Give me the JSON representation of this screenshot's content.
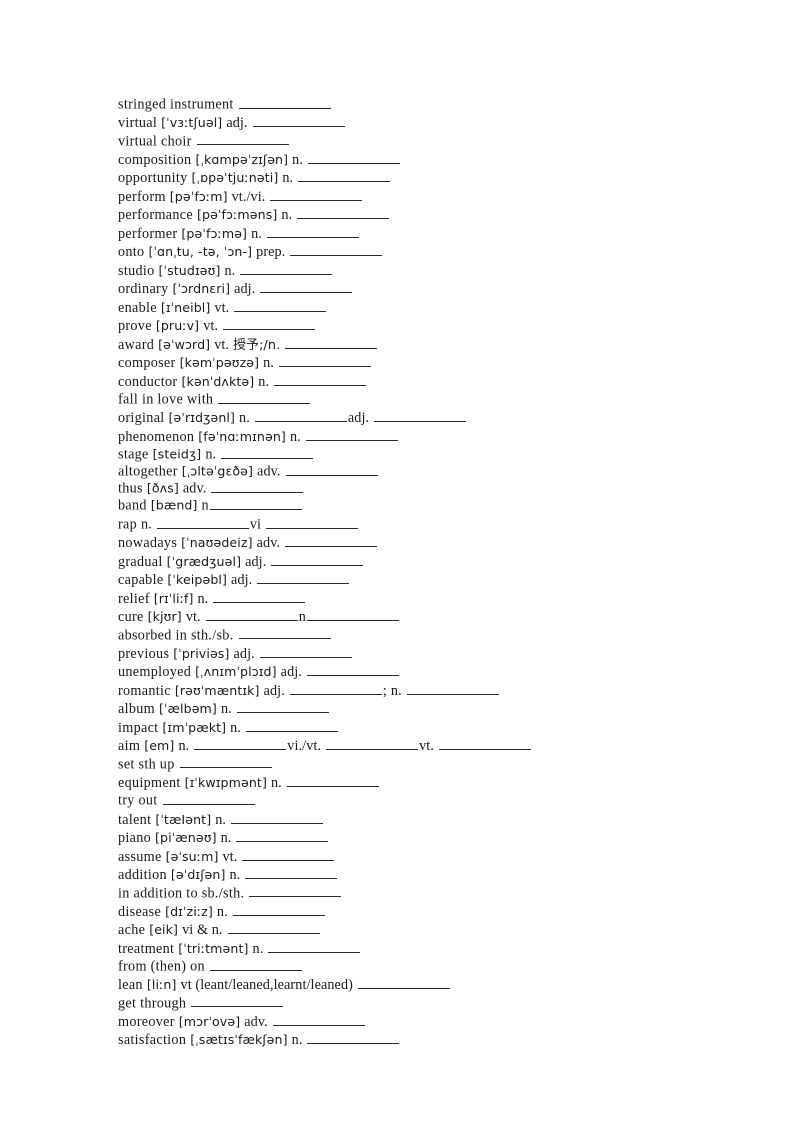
{
  "document": {
    "type": "vocabulary-worksheet",
    "language": "English",
    "entry_count": 48
  },
  "entries": [
    {
      "word": "stringed instrument",
      "ipa": "",
      "pos": "",
      "note": "",
      "blanks": [
        1
      ],
      "tight": false
    },
    {
      "word": "virtual",
      "ipa": "[ˈvɜːtʃuəl]",
      "pos": "adj.",
      "note": "",
      "blanks": [
        1
      ],
      "tight": false
    },
    {
      "word": "virtual choir",
      "ipa": "",
      "pos": "",
      "note": "",
      "blanks": [
        1
      ],
      "tight": false
    },
    {
      "word": "composition",
      "ipa": "[ˌkɑmpəˈzɪʃən]",
      "pos": "n.",
      "note": "",
      "blanks": [
        1
      ],
      "tight": false
    },
    {
      "word": "opportunity",
      "ipa": "[ˌɒpəˈtjuːnəti]",
      "pos": "n.",
      "note": "",
      "blanks": [
        1
      ],
      "tight": false
    },
    {
      "word": "perform",
      "ipa": "[pəˈfɔːm]",
      "pos": "vt./vi.",
      "note": "",
      "blanks": [
        1
      ],
      "tight": false
    },
    {
      "word": "performance",
      "ipa": "[pəˈfɔːməns]",
      "pos": "n.",
      "note": "",
      "blanks": [
        1
      ],
      "tight": false
    },
    {
      "word": "performer",
      "ipa": "[pəˈfɔːmə]",
      "pos": "n.",
      "note": "",
      "blanks": [
        1
      ],
      "tight": false
    },
    {
      "word": "onto",
      "ipa": "[ˈɑnˌtu, -tə, ˈɔn-]",
      "pos": "prep.",
      "note": "",
      "blanks": [
        1
      ],
      "tight": false
    },
    {
      "word": "studio",
      "ipa": "[ˈstudɪəʊ]",
      "pos": "n.",
      "note": "",
      "blanks": [
        1
      ],
      "tight": false
    },
    {
      "word": "ordinary",
      "ipa": "[ˈɔrdnɛri]",
      "pos": "adj.",
      "note": "",
      "blanks": [
        1
      ],
      "tight": false
    },
    {
      "word": "enable",
      "ipa": "[ɪˈneibl]",
      "pos": "vt.",
      "note": "",
      "blanks": [
        1
      ],
      "tight": false
    },
    {
      "word": "prove",
      "ipa": "[pruːv]",
      "pos": "vt.",
      "note": "",
      "blanks": [
        1
      ],
      "tight": false
    },
    {
      "word": "award",
      "ipa": "[əˈwɔrd]",
      "pos": "vt.",
      "note": "授予;/n.",
      "blanks": [
        1
      ],
      "tight": false
    },
    {
      "word": "composer",
      "ipa": "[kəmˈpəʊzə]",
      "pos": "n.",
      "note": "",
      "blanks": [
        1
      ],
      "tight": false
    },
    {
      "word": "conductor",
      "ipa": "[kənˈdʌktə]",
      "pos": "n.",
      "note": "",
      "blanks": [
        1
      ],
      "tight": false
    },
    {
      "word": "fall in love with",
      "ipa": "",
      "pos": "",
      "note": "",
      "blanks": [
        1
      ],
      "tight": false
    },
    {
      "word": "original",
      "ipa": "[əˈrɪdʒənl]",
      "pos": "n.",
      "note": "",
      "blanks": [
        1
      ],
      "tight": false,
      "trailing_pos": "adj.",
      "trailing_blanks": [
        1
      ]
    },
    {
      "word": "phenomenon",
      "ipa": "[fəˈnɑːmɪnən]",
      "pos": "n.",
      "note": "",
      "blanks": [
        1
      ],
      "tight": false
    },
    {
      "word": "stage",
      "ipa": "[steidʒ]",
      "pos": "n.",
      "note": "",
      "blanks": [
        1
      ],
      "tight": true
    },
    {
      "word": "altogether",
      "ipa": "[ˌɔltəˈgɛðə]",
      "pos": "adv.",
      "note": "",
      "blanks": [
        1
      ],
      "tight": true
    },
    {
      "word": "thus",
      "ipa": "[ðʌs]",
      "pos": "adv.",
      "note": "",
      "blanks": [
        1
      ],
      "tight": true
    },
    {
      "word": "band",
      "ipa": "[bænd]",
      "pos": "n",
      "note": "",
      "blanks": [
        1
      ],
      "tight": true,
      "no_space_before_blank": true
    },
    {
      "word": "rap",
      "ipa": "",
      "pos": "n.",
      "note": "",
      "blanks": [
        1
      ],
      "tight": false,
      "trailing_pos": "vi",
      "trailing_blanks": [
        1
      ]
    },
    {
      "word": "nowadays",
      "ipa": "[ˈnaʊədeiz]",
      "pos": "adv.",
      "note": "",
      "blanks": [
        1
      ],
      "tight": false
    },
    {
      "word": "gradual",
      "ipa": "[ˈgrædʒuəl]",
      "pos": "adj.",
      "note": "",
      "blanks": [
        1
      ],
      "tight": false
    },
    {
      "word": "capable",
      "ipa": "[ˈkeipəbl]",
      "pos": "adj.",
      "note": "",
      "blanks": [
        1
      ],
      "tight": false
    },
    {
      "word": "relief",
      "ipa": "[rɪˈliːf]",
      "pos": "n.",
      "note": "",
      "blanks": [
        1
      ],
      "tight": false
    },
    {
      "word": "cure",
      "ipa": "[kjʊr]",
      "pos": "vt.",
      "note": "",
      "blanks": [
        1
      ],
      "tight": false,
      "trailing_pos": "n",
      "trailing_blanks": [
        1
      ],
      "trailing_tight": true
    },
    {
      "word": "absorbed in sth./sb.",
      "ipa": "",
      "pos": "",
      "note": "",
      "blanks": [
        1
      ],
      "tight": false
    },
    {
      "word": "previous",
      "ipa": "[ˈpriviəs]",
      "pos": "adj.",
      "note": "",
      "blanks": [
        1
      ],
      "tight": false
    },
    {
      "word": "unemployed",
      "ipa": "[ˌʌnɪmˈplɔɪd]",
      "pos": "adj.",
      "note": "",
      "blanks": [
        1
      ],
      "tight": false
    },
    {
      "word": "romantic",
      "ipa": "[rəʊˈmæntɪk]",
      "pos": "adj.",
      "note": "",
      "blanks": [
        1
      ],
      "tight": false,
      "separator": ";",
      "trailing_pos": "n.",
      "trailing_blanks": [
        1
      ]
    },
    {
      "word": "album",
      "ipa": "[ˈælbəm]",
      "pos": "n.",
      "note": "",
      "blanks": [
        1
      ],
      "tight": false
    },
    {
      "word": "impact",
      "ipa": "[ɪmˈpækt]",
      "pos": "n.",
      "note": "",
      "blanks": [
        1
      ],
      "tight": false
    },
    {
      "word": "aim",
      "ipa": "[em]",
      "pos": "n.",
      "note": "",
      "blanks": [
        1
      ],
      "tight": false,
      "trailing_pos": "vi./vt.",
      "trailing_blanks": [
        1
      ],
      "trailing_pos2": "vt.",
      "trailing_blanks2": [
        1
      ]
    },
    {
      "word": "set sth up",
      "ipa": "",
      "pos": "",
      "note": "",
      "blanks": [
        1
      ],
      "tight": false
    },
    {
      "word": "equipment",
      "ipa": "[ɪˈkwɪpmənt]",
      "pos": "n.",
      "note": "",
      "blanks": [
        1
      ],
      "tight": false
    },
    {
      "word": "try out",
      "ipa": "",
      "pos": "",
      "note": "",
      "blanks": [
        1
      ],
      "tight": false
    },
    {
      "word": "talent",
      "ipa": "[ˈtæIənt]",
      "pos": "n.",
      "note": "",
      "blanks": [
        1
      ],
      "tight": false
    },
    {
      "word": "piano",
      "ipa": "[piˈænəʊ]",
      "pos": "n.",
      "note": "",
      "blanks": [
        1
      ],
      "tight": false
    },
    {
      "word": "assume",
      "ipa": "[əˈsuːm]",
      "pos": "vt.",
      "note": "",
      "blanks": [
        1
      ],
      "tight": false
    },
    {
      "word": "addition",
      "ipa": "[əˈdɪʃən]",
      "pos": "n.",
      "note": "",
      "blanks": [
        1
      ],
      "tight": false
    },
    {
      "word": "in addition to sb./sth.",
      "ipa": "",
      "pos": "",
      "note": "",
      "blanks": [
        1
      ],
      "tight": false
    },
    {
      "word": "disease",
      "ipa": "[dɪˈziːz]",
      "pos": "n.",
      "note": "",
      "blanks": [
        1
      ],
      "tight": false
    },
    {
      "word": "ache",
      "ipa": "[eik]",
      "pos": "vi & n.",
      "note": "",
      "blanks": [
        1
      ],
      "tight": false
    },
    {
      "word": "treatment",
      "ipa": "[ˈtriːtmənt]",
      "pos": "n.",
      "note": "",
      "blanks": [
        1
      ],
      "tight": false
    },
    {
      "word": "from (then) on",
      "ipa": "",
      "pos": "",
      "note": "",
      "blanks": [
        1
      ],
      "tight": false
    },
    {
      "word": "lean",
      "ipa": "[liːn]",
      "pos": "vt (leant/leaned,learnt/leaned)",
      "note": "",
      "blanks": [
        1
      ],
      "tight": false
    },
    {
      "word": "get through",
      "ipa": "",
      "pos": "",
      "note": "",
      "blanks": [
        1
      ],
      "tight": false
    },
    {
      "word": "moreover",
      "ipa": "[mɔrˈovə]",
      "pos": "adv.",
      "note": "",
      "blanks": [
        1
      ],
      "tight": false
    },
    {
      "word": "satisfaction",
      "ipa": "[ˌsætɪsˈfækʃən]",
      "pos": "n.",
      "note": "",
      "blanks": [
        1
      ],
      "tight": false
    }
  ],
  "blank_widths": {
    "default": 92,
    "short": 74,
    "long": 104
  }
}
